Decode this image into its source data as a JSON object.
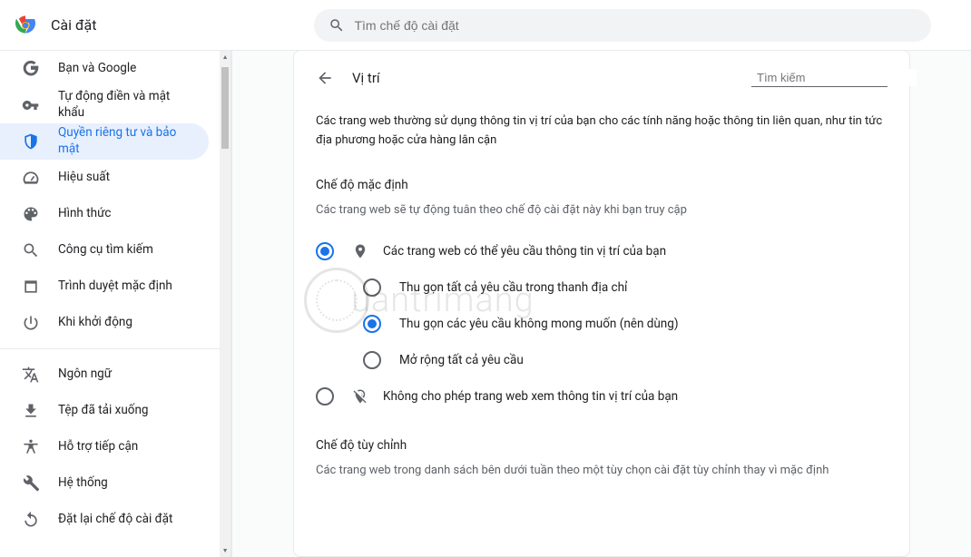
{
  "header": {
    "title": "Cài đặt",
    "search_placeholder": "Tìm chế độ cài đặt"
  },
  "sidebar": {
    "items": [
      {
        "key": "you",
        "label": "Bạn và Google"
      },
      {
        "key": "autofill",
        "label": "Tự động điền và mật khẩu"
      },
      {
        "key": "privacy",
        "label": "Quyền riêng tư và bảo mật"
      },
      {
        "key": "performance",
        "label": "Hiệu suất"
      },
      {
        "key": "appearance",
        "label": "Hình thức"
      },
      {
        "key": "search",
        "label": "Công cụ tìm kiếm"
      },
      {
        "key": "default",
        "label": "Trình duyệt mặc định"
      },
      {
        "key": "startup",
        "label": "Khi khởi động"
      }
    ],
    "items2": [
      {
        "key": "languages",
        "label": "Ngôn ngữ"
      },
      {
        "key": "downloads",
        "label": "Tệp đã tải xuống"
      },
      {
        "key": "accessibility",
        "label": "Hỗ trợ tiếp cận"
      },
      {
        "key": "system",
        "label": "Hệ thống"
      },
      {
        "key": "reset",
        "label": "Đặt lại chế độ cài đặt"
      }
    ]
  },
  "page": {
    "title": "Vị trí",
    "search_placeholder": "Tìm kiếm",
    "description": "Các trang web thường sử dụng thông tin vị trí của bạn cho các tính năng hoặc thông tin liên quan, như tin tức địa phương hoặc cửa hàng lân cận",
    "default_mode_title": "Chế độ mặc định",
    "default_mode_sub": "Các trang web sẽ tự động tuân theo chế độ cài đặt này khi bạn truy cập",
    "options": {
      "can_ask": "Các trang web có thể yêu cầu thông tin vị trí của bạn",
      "collapse_all": "Thu gọn tất cả yêu cầu trong thanh địa chỉ",
      "collapse_unwanted": "Thu gọn các yêu cầu không mong muốn (nên dùng)",
      "expand_all": "Mở rộng tất cả yêu cầu",
      "block": "Không cho phép trang web xem thông tin vị trí của bạn"
    },
    "custom_title": "Chế độ tùy chỉnh",
    "custom_sub": "Các trang web trong danh sách bên dưới tuần theo một tùy chọn cài đặt tùy chỉnh thay vì mặc định"
  },
  "watermark": "uantrimang"
}
